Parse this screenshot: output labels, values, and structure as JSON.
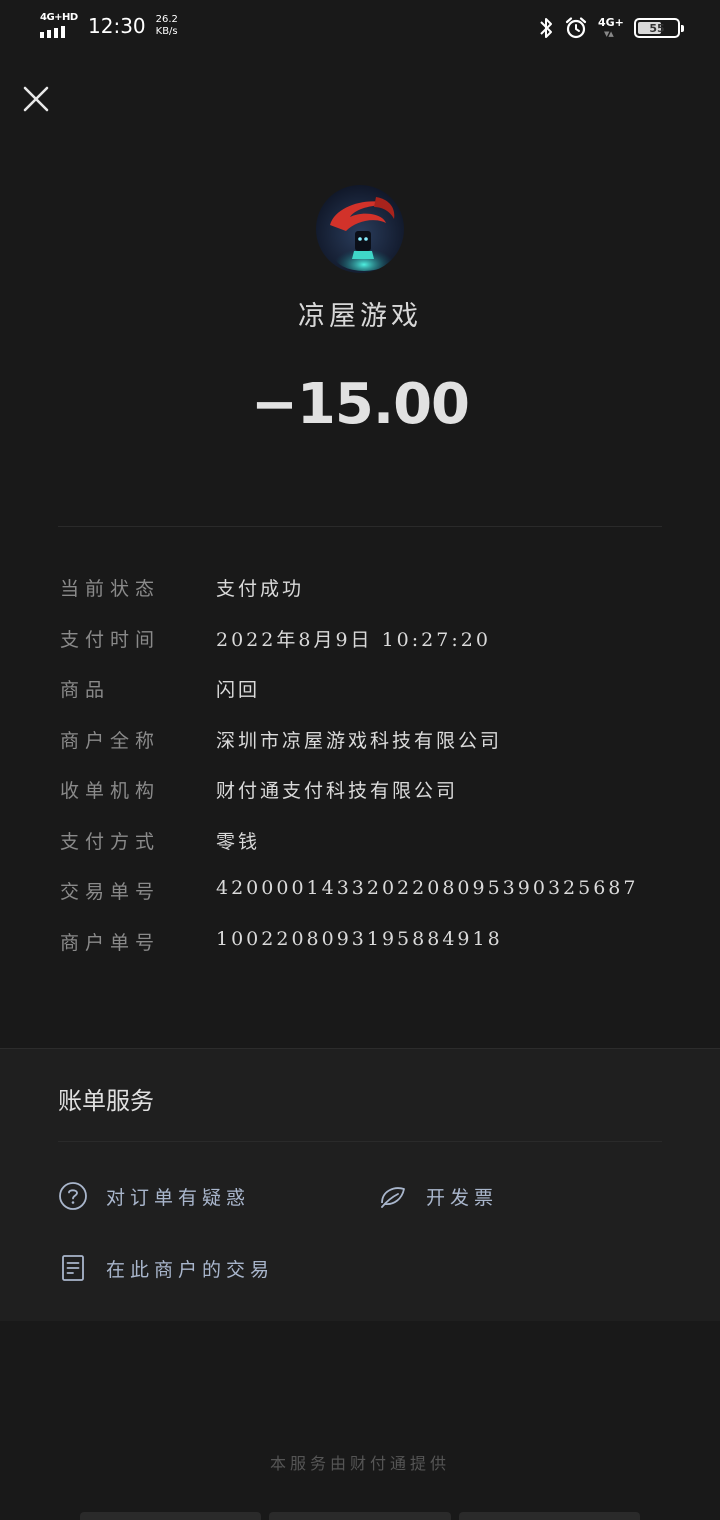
{
  "status_bar": {
    "network_left": "4G+HD",
    "time": "12:30",
    "speed_value": "26.2",
    "speed_unit": "KB/s",
    "network_right": "4G+",
    "battery_level": "55"
  },
  "header": {
    "close_icon": "close-icon",
    "merchant_name": "凉屋游戏",
    "amount": "−15.00"
  },
  "details": [
    {
      "label": "当前状态",
      "value": "支付成功"
    },
    {
      "label": "支付时间",
      "value": "2022年8月9日 10:27:20"
    },
    {
      "label": "商品",
      "value": "闪回"
    },
    {
      "label": "商户全称",
      "value": "深圳市凉屋游戏科技有限公司"
    },
    {
      "label": "收单机构",
      "value": "财付通支付科技有限公司"
    },
    {
      "label": "支付方式",
      "value": "零钱"
    },
    {
      "label": "交易单号",
      "value": "4200001433202208095390325687"
    },
    {
      "label": "商户单号",
      "value": "10022080931958849​18"
    }
  ],
  "services": {
    "title": "账单服务",
    "items": [
      {
        "label": "对订单有疑惑",
        "icon": "question-circle-icon"
      },
      {
        "label": "开发票",
        "icon": "invoice-leaf-icon"
      },
      {
        "label": "在此商户的交易",
        "icon": "document-list-icon"
      }
    ]
  },
  "footer": {
    "note": "本服务由财付通提供"
  },
  "colors": {
    "background": "#191919",
    "card": "#1f1f1f",
    "link": "#a9b6cc"
  }
}
